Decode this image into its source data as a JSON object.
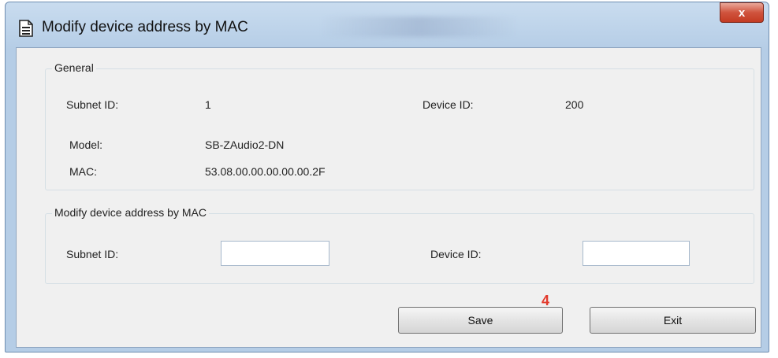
{
  "window": {
    "title": "Modify device address by MAC",
    "close_glyph": "x",
    "icon": "document-icon"
  },
  "general": {
    "group_title": "General",
    "subnet_id_label": "Subnet ID:",
    "subnet_id_value": "1",
    "device_id_label": "Device ID:",
    "device_id_value": "200",
    "model_label": "Model:",
    "model_value": "SB-ZAudio2-DN",
    "mac_label": "MAC:",
    "mac_value": "53.08.00.00.00.00.00.2F"
  },
  "modify": {
    "group_title": "Modify device address by MAC",
    "subnet_id_label": "Subnet ID:",
    "subnet_id_value": "",
    "device_id_label": "Device ID:",
    "device_id_value": ""
  },
  "buttons": {
    "save_label": "Save",
    "exit_label": "Exit"
  },
  "annotation": {
    "step_number": "4",
    "color": "#e23a2c"
  }
}
